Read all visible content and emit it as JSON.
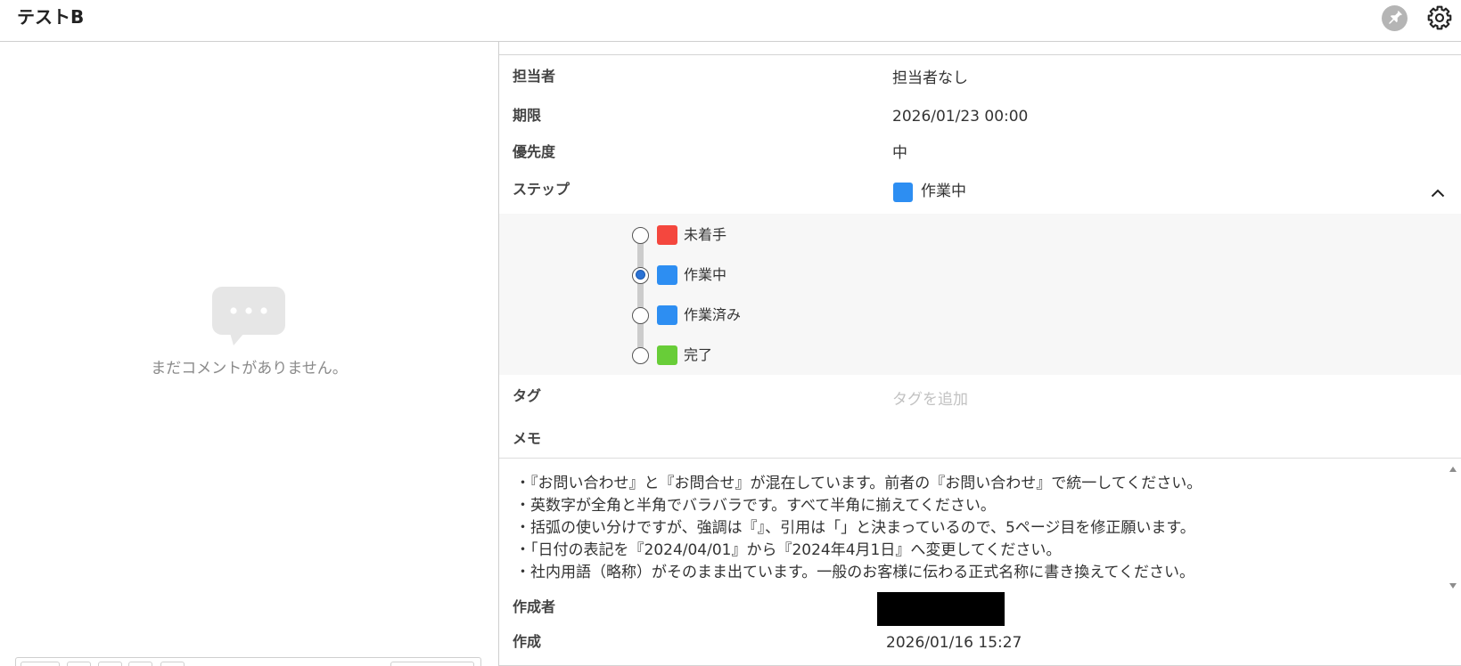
{
  "header": {
    "title": "テストB",
    "pin_icon": "pin-icon",
    "settings_icon": "gear-icon"
  },
  "comments": {
    "empty_icon": "speech-bubble-icon",
    "empty_message": "まだコメントがありません。"
  },
  "details": {
    "assignee": {
      "label": "担当者",
      "value": "担当者なし"
    },
    "due": {
      "label": "期限",
      "value": "2026/01/23 00:00"
    },
    "priority": {
      "label": "優先度",
      "value": "中"
    },
    "step": {
      "label": "ステップ",
      "toggle_icon": "chevron-up-icon",
      "current": {
        "name": "作業中",
        "color": "#2d8ef2"
      },
      "options": [
        {
          "name": "未着手",
          "color": "#f4473e",
          "selected": false
        },
        {
          "name": "作業中",
          "color": "#2d8ef2",
          "selected": true
        },
        {
          "name": "作業済み",
          "color": "#2d8ef2",
          "selected": false
        },
        {
          "name": "完了",
          "color": "#68cd38",
          "selected": false
        }
      ]
    },
    "tags": {
      "label": "タグ",
      "placeholder": "タグを追加"
    },
    "memo": {
      "label": "メモ",
      "lines": [
        "・『お問い合わせ』と『お問合せ』が混在しています。前者の『お問い合わせ』で統一してください。",
        "・英数字が全角と半角でバラバラです。すべて半角に揃えてください。",
        "・括弧の使い分けですが、強調は『』、引用は「」と決まっているので、5ページ目を修正願います。",
        "・「日付の表記を『2024/04/01』から『2024年4月1日』へ変更してください。",
        "・社内用語（略称）がそのまま出ています。一般のお客様に伝わる正式名称に書き換えてください。"
      ]
    },
    "creator": {
      "label": "作成者"
    },
    "created": {
      "label": "作成",
      "value": "2026/01/16 15:27"
    }
  }
}
